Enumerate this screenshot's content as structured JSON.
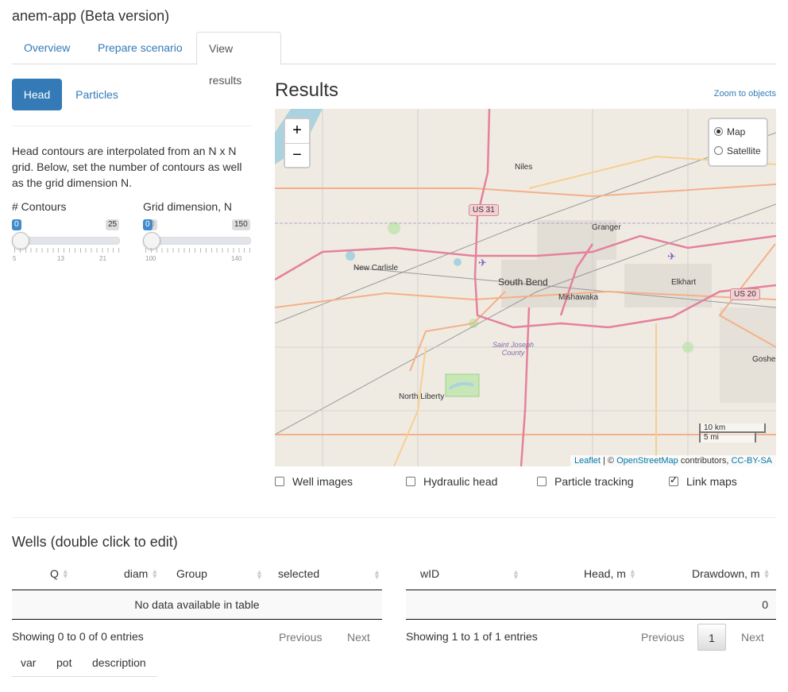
{
  "app": {
    "title": "anem-app (Beta version)"
  },
  "tabs": [
    {
      "label": "Overview"
    },
    {
      "label": "Prepare scenario"
    },
    {
      "label": "View results"
    }
  ],
  "sidebar": {
    "pills": [
      {
        "label": "Head"
      },
      {
        "label": "Particles"
      }
    ],
    "description": "Head contours are interpolated from an N x N grid. Below, set the number of contours as well as the grid dimension N.",
    "contours": {
      "label": "# Contours",
      "value": "0",
      "max": "25",
      "ticks": [
        "5",
        "13",
        "21"
      ]
    },
    "grid": {
      "label": "Grid dimension, N",
      "value": "0",
      "min_hidden": "0",
      "max": "150",
      "ticks": [
        "100",
        "140"
      ]
    }
  },
  "results": {
    "title": "Results",
    "zoom_link": "Zoom to objects",
    "map": {
      "zoom_in": "+",
      "zoom_out": "−",
      "layers": [
        {
          "label": "Map",
          "selected": true
        },
        {
          "label": "Satellite",
          "selected": false
        }
      ],
      "labels": {
        "niles": "Niles",
        "granger": "Granger",
        "new_carlisle": "New Carlisle",
        "south_bend": "South Bend",
        "mishawaka": "Mishawaka",
        "elkhart": "Elkhart",
        "county": "Saint Joseph County",
        "north_liberty": "North Liberty",
        "goshen": "Goshe"
      },
      "shields": {
        "us31": "US 31",
        "us20": "US 20"
      },
      "scale": {
        "km": "10 km",
        "mi": "5 mi"
      },
      "attribution": {
        "leaflet": "Leaflet",
        "sep": "| ©",
        "osm": "OpenStreetMap",
        "contrib": "contributors,",
        "license": "CC-BY-SA"
      }
    },
    "checkboxes": [
      {
        "label": "Well images",
        "checked": false
      },
      {
        "label": "Hydraulic head",
        "checked": false
      },
      {
        "label": "Particle tracking",
        "checked": false
      },
      {
        "label": "Link maps",
        "checked": true
      }
    ]
  },
  "wells": {
    "title": "Wells (double click to edit)",
    "left_table": {
      "columns": [
        "Q",
        "diam",
        "Group",
        "selected"
      ],
      "empty": "No data available in table",
      "info": "Showing 0 to 0 of 0 entries",
      "prev": "Previous",
      "next": "Next"
    },
    "right_table": {
      "columns": [
        "wID",
        "Head, m",
        "Drawdown, m"
      ],
      "rows": [
        {
          "drawdown": "0"
        }
      ],
      "info": "Showing 1 to 1 of 1 entries",
      "prev": "Previous",
      "page": "1",
      "next": "Next"
    },
    "params_columns": [
      "var",
      "pot",
      "description"
    ]
  }
}
